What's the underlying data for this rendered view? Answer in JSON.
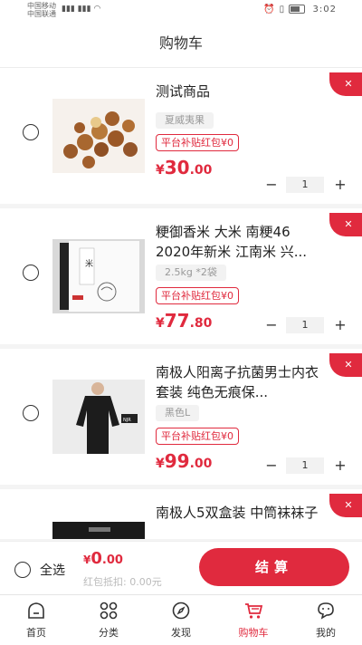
{
  "status_bar": {
    "carrier1": "中国移动",
    "carrier2": "中国联通",
    "time": "3:02"
  },
  "header": {
    "title": "购物车"
  },
  "cart": {
    "items": [
      {
        "name": "测试商品",
        "spec": "夏威夷果",
        "subsidy": "平台补贴红包¥0",
        "currency": "¥",
        "price_int": "30",
        "price_dec": ".00",
        "qty": "1",
        "image": "macadamia-nuts-photo"
      },
      {
        "name": "粳御香米 大米 南粳46 2020年新米 江南米 兴...",
        "spec": "2.5kg *2袋",
        "subsidy": "平台补贴红包¥0",
        "currency": "¥",
        "price_int": "77",
        "price_dec": ".80",
        "qty": "1",
        "image": "rice-bag-photo"
      },
      {
        "name": "南极人阳离子抗菌男士内衣套装 纯色无痕保...",
        "spec": "黑色L",
        "subsidy": "平台补贴红包¥0",
        "currency": "¥",
        "price_int": "99",
        "price_dec": ".00",
        "qty": "1",
        "image": "thermal-underwear-photo"
      },
      {
        "name": "南极人5双盒装 中筒袜袜子",
        "spec": "",
        "subsidy": "",
        "currency": "",
        "price_int": "",
        "price_dec": "",
        "qty": "",
        "image": "socks-box-photo"
      }
    ],
    "minus": "−",
    "plus": "+",
    "delete": "✕"
  },
  "checkout": {
    "select_all": "全选",
    "currency": "¥",
    "total_int": "0",
    "total_dec": ".00",
    "deduct": "红包抵扣: 0.00元",
    "settle": "结算"
  },
  "tabbar": {
    "tabs": [
      {
        "label": "首页",
        "icon": "home-icon"
      },
      {
        "label": "分类",
        "icon": "category-icon"
      },
      {
        "label": "发现",
        "icon": "compass-icon"
      },
      {
        "label": "购物车",
        "icon": "cart-icon",
        "active": true
      },
      {
        "label": "我的",
        "icon": "profile-icon"
      }
    ]
  },
  "colors": {
    "accent": "#e02a3e",
    "background": "#f4f4f4"
  }
}
